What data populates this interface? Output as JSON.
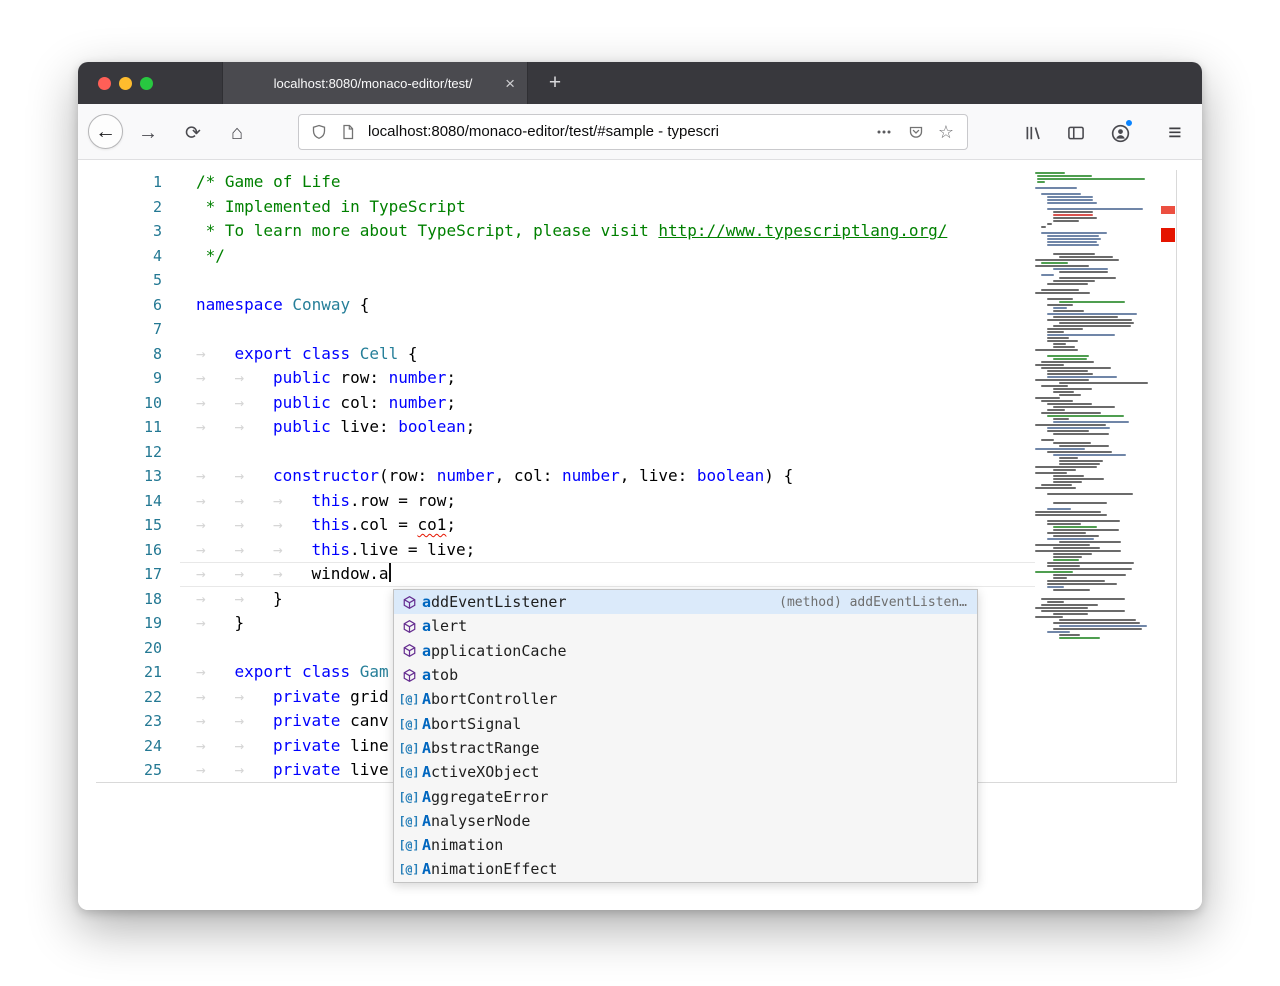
{
  "browser": {
    "tab_title": "localhost:8080/monaco-editor/test/",
    "url_text": "localhost:8080/monaco-editor/test/#sample - typescri"
  },
  "icons": {
    "back": "←",
    "forward": "→",
    "reload": "⟳",
    "home": "⌂",
    "star": "☆",
    "menu": "≡",
    "new_tab": "+",
    "tab_close": "×",
    "whitespace": "→",
    "class_symbol": "[@]"
  },
  "theme": {
    "accent": "#0a84ff",
    "keyword": "#0000ff",
    "comment": "#008000",
    "type": "#267f99",
    "error": "#e51400",
    "linenumber": "#237893",
    "selection_bg": "#dbeafa",
    "match": "#0066bf",
    "icon_method": "#652d90",
    "icon_class": "#2980b9",
    "mac_red": "#ff5f57",
    "mac_yellow": "#febc2e",
    "mac_green": "#28c840"
  },
  "editor": {
    "whitespace_glyph": "→",
    "lines": [
      {
        "n": "1",
        "indent": 0,
        "segs": [
          {
            "t": "/* Game of Life",
            "s": "cm"
          }
        ]
      },
      {
        "n": "2",
        "indent": 0,
        "segs": [
          {
            "t": " * Implemented in TypeScript",
            "s": "cm"
          }
        ]
      },
      {
        "n": "3",
        "indent": 0,
        "segs": [
          {
            "t": " * To learn more about TypeScript, please visit ",
            "s": "cm"
          },
          {
            "t": "http://www.typescriptlang.org/",
            "s": "lk"
          }
        ]
      },
      {
        "n": "4",
        "indent": 0,
        "segs": [
          {
            "t": " */",
            "s": "cm"
          }
        ]
      },
      {
        "n": "5",
        "indent": 0,
        "segs": []
      },
      {
        "n": "6",
        "indent": 0,
        "segs": [
          {
            "t": "namespace",
            "s": "kw"
          },
          {
            "t": " ",
            "s": "pl"
          },
          {
            "t": "Conway",
            "s": "ty"
          },
          {
            "t": " {",
            "s": "pl"
          }
        ]
      },
      {
        "n": "7",
        "indent": 0,
        "segs": []
      },
      {
        "n": "8",
        "indent": 1,
        "segs": [
          {
            "t": "export",
            "s": "kw"
          },
          {
            "t": " ",
            "s": "pl"
          },
          {
            "t": "class",
            "s": "kw"
          },
          {
            "t": " ",
            "s": "pl"
          },
          {
            "t": "Cell",
            "s": "ty"
          },
          {
            "t": " {",
            "s": "pl"
          }
        ]
      },
      {
        "n": "9",
        "indent": 2,
        "segs": [
          {
            "t": "public",
            "s": "kw"
          },
          {
            "t": " row: ",
            "s": "pl"
          },
          {
            "t": "number",
            "s": "kw"
          },
          {
            "t": ";",
            "s": "pl"
          }
        ]
      },
      {
        "n": "10",
        "indent": 2,
        "segs": [
          {
            "t": "public",
            "s": "kw"
          },
          {
            "t": " col: ",
            "s": "pl"
          },
          {
            "t": "number",
            "s": "kw"
          },
          {
            "t": ";",
            "s": "pl"
          }
        ]
      },
      {
        "n": "11",
        "indent": 2,
        "segs": [
          {
            "t": "public",
            "s": "kw"
          },
          {
            "t": " live: ",
            "s": "pl"
          },
          {
            "t": "boolean",
            "s": "kw"
          },
          {
            "t": ";",
            "s": "pl"
          }
        ]
      },
      {
        "n": "12",
        "indent": 0,
        "segs": []
      },
      {
        "n": "13",
        "indent": 2,
        "segs": [
          {
            "t": "constructor",
            "s": "kw"
          },
          {
            "t": "(row: ",
            "s": "pl"
          },
          {
            "t": "number",
            "s": "kw"
          },
          {
            "t": ", col: ",
            "s": "pl"
          },
          {
            "t": "number",
            "s": "kw"
          },
          {
            "t": ", live: ",
            "s": "pl"
          },
          {
            "t": "boolean",
            "s": "kw"
          },
          {
            "t": ") {",
            "s": "pl"
          }
        ]
      },
      {
        "n": "14",
        "indent": 3,
        "segs": [
          {
            "t": "this",
            "s": "kw"
          },
          {
            "t": ".row = row;",
            "s": "pl"
          }
        ]
      },
      {
        "n": "15",
        "indent": 3,
        "segs": [
          {
            "t": "this",
            "s": "kw"
          },
          {
            "t": ".col = ",
            "s": "pl"
          },
          {
            "t": "co1",
            "s": "er"
          },
          {
            "t": ";",
            "s": "pl"
          }
        ]
      },
      {
        "n": "16",
        "indent": 3,
        "segs": [
          {
            "t": "this",
            "s": "kw"
          },
          {
            "t": ".live = live;",
            "s": "pl"
          }
        ]
      },
      {
        "n": "17",
        "indent": 3,
        "cursor": true,
        "segs": [
          {
            "t": "window.a",
            "s": "pl"
          }
        ]
      },
      {
        "n": "18",
        "indent": 2,
        "segs": [
          {
            "t": "}",
            "s": "pl"
          }
        ]
      },
      {
        "n": "19",
        "indent": 1,
        "segs": [
          {
            "t": "}",
            "s": "pl"
          }
        ]
      },
      {
        "n": "20",
        "indent": 0,
        "segs": []
      },
      {
        "n": "21",
        "indent": 1,
        "segs": [
          {
            "t": "export",
            "s": "kw"
          },
          {
            "t": " ",
            "s": "pl"
          },
          {
            "t": "class",
            "s": "kw"
          },
          {
            "t": " ",
            "s": "pl"
          },
          {
            "t": "Gam",
            "s": "ty"
          }
        ]
      },
      {
        "n": "22",
        "indent": 2,
        "segs": [
          {
            "t": "private",
            "s": "kw"
          },
          {
            "t": " grid",
            "s": "pl"
          }
        ]
      },
      {
        "n": "23",
        "indent": 2,
        "segs": [
          {
            "t": "private",
            "s": "kw"
          },
          {
            "t": " canv",
            "s": "pl"
          }
        ]
      },
      {
        "n": "24",
        "indent": 2,
        "segs": [
          {
            "t": "private",
            "s": "kw"
          },
          {
            "t": " line",
            "s": "pl"
          }
        ]
      },
      {
        "n": "25",
        "indent": 2,
        "segs": [
          {
            "t": "private",
            "s": "kw"
          },
          {
            "t": " live",
            "s": "pl"
          }
        ]
      }
    ]
  },
  "suggest": {
    "items": [
      {
        "label": "addEventListener",
        "kind": "method",
        "detail": "(method) addEventListen…",
        "selected": true
      },
      {
        "label": "alert",
        "kind": "method"
      },
      {
        "label": "applicationCache",
        "kind": "method"
      },
      {
        "label": "atob",
        "kind": "method"
      },
      {
        "label": "AbortController",
        "kind": "class"
      },
      {
        "label": "AbortSignal",
        "kind": "class"
      },
      {
        "label": "AbstractRange",
        "kind": "class"
      },
      {
        "label": "ActiveXObject",
        "kind": "class"
      },
      {
        "label": "AggregateError",
        "kind": "class"
      },
      {
        "label": "AnalyserNode",
        "kind": "class"
      },
      {
        "label": "Animation",
        "kind": "class"
      },
      {
        "label": "AnimationEffect",
        "kind": "class"
      }
    ]
  }
}
